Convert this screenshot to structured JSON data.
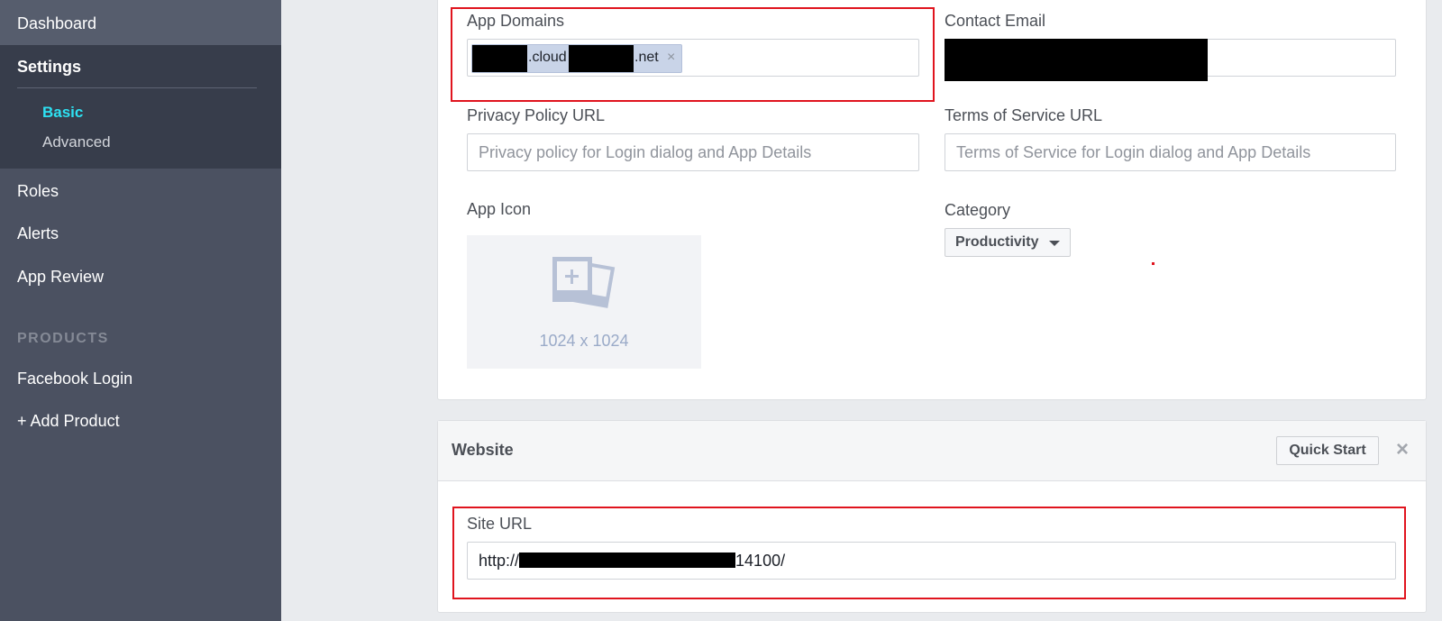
{
  "sidebar": {
    "dashboard": "Dashboard",
    "settings": "Settings",
    "basic": "Basic",
    "advanced": "Advanced",
    "roles": "Roles",
    "alerts": "Alerts",
    "app_review": "App Review",
    "products_heading": "PRODUCTS",
    "facebook_login": "Facebook Login",
    "add_product": "+ Add Product"
  },
  "basic": {
    "app_domains_label": "App Domains",
    "app_domain_token_part1": ".cloud",
    "app_domain_token_part2": ".net",
    "token_remove": "×",
    "contact_email_label": "Contact Email",
    "privacy_label": "Privacy Policy URL",
    "privacy_placeholder": "Privacy policy for Login dialog and App Details",
    "tos_label": "Terms of Service URL",
    "tos_placeholder": "Terms of Service for Login dialog and App Details",
    "app_icon_label": "App Icon",
    "app_icon_size": "1024 x 1024",
    "category_label": "Category",
    "category_value": "Productivity"
  },
  "website": {
    "title": "Website",
    "quick_start": "Quick Start",
    "close": "×",
    "site_url_label": "Site URL",
    "site_url_prefix": "http://",
    "site_url_suffix": "14100/"
  },
  "colors": {
    "sidebar": "#4b5161",
    "sidebar_active_group": "#373d4b",
    "active_link": "#2de1f2",
    "highlight": "#e0141e"
  }
}
